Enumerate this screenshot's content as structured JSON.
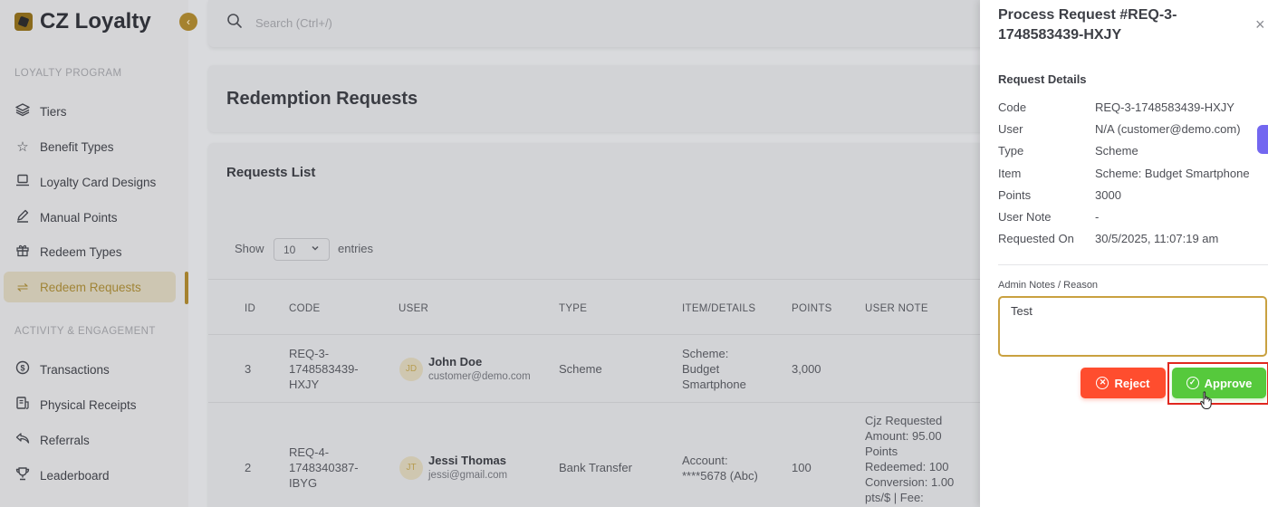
{
  "brand": {
    "name": "CZ Loyalty"
  },
  "sidebar": {
    "sections": [
      {
        "label": "LOYALTY PROGRAM"
      },
      {
        "label": "ACTIVITY & ENGAGEMENT"
      }
    ],
    "items": [
      {
        "label": "Tiers",
        "icon": "layers-icon"
      },
      {
        "label": "Benefit Types",
        "icon": "star-icon"
      },
      {
        "label": "Loyalty Card Designs",
        "icon": "laptop-icon"
      },
      {
        "label": "Manual Points",
        "icon": "pencil-icon"
      },
      {
        "label": "Redeem Types",
        "icon": "gift-icon"
      },
      {
        "label": "Redeem Requests",
        "icon": "swap-icon",
        "active": true
      },
      {
        "label": "Transactions",
        "icon": "dollar-icon"
      },
      {
        "label": "Physical Receipts",
        "icon": "receipt-icon"
      },
      {
        "label": "Referrals",
        "icon": "share-icon"
      },
      {
        "label": "Leaderboard",
        "icon": "trophy-icon"
      }
    ]
  },
  "search": {
    "placeholder": "Search (Ctrl+/)"
  },
  "page": {
    "title": "Redemption Requests"
  },
  "list": {
    "title": "Requests List",
    "show_label": "Show",
    "entries_value": "10",
    "entries_label": "entries",
    "columns": [
      "ID",
      "CODE",
      "USER",
      "TYPE",
      "ITEM/DETAILS",
      "POINTS",
      "USER NOTE"
    ],
    "rows": [
      {
        "id": "3",
        "code": "REQ-3-\n1748583439-\nHXJY",
        "initials": "JD",
        "user_name": "John Doe",
        "user_email": "customer@demo.com",
        "type": "Scheme",
        "item": "Scheme:\nBudget\nSmartphone",
        "points": "3,000",
        "note": ""
      },
      {
        "id": "2",
        "code": "REQ-4-\n1748340387-\nIBYG",
        "initials": "JT",
        "user_name": "Jessi Thomas",
        "user_email": "jessi@gmail.com",
        "type": "Bank Transfer",
        "item": "Account:\n****5678 (Abc)",
        "points": "100",
        "note": "Cjz Requested\nAmount: 95.00\nPoints\nRedeemed: 100\nConversion: 1.00\npts/$ | Fee:"
      }
    ]
  },
  "drawer": {
    "title": "Process Request #REQ-3-1748583439-HXJY",
    "close_icon": "×",
    "details_title": "Request Details",
    "details": [
      {
        "key": "Code",
        "value": "REQ-3-1748583439-HXJY"
      },
      {
        "key": "User",
        "value": "N/A (customer@demo.com)"
      },
      {
        "key": "Type",
        "value": "Scheme"
      },
      {
        "key": "Item",
        "value": "Scheme: Budget Smartphone"
      },
      {
        "key": "Points",
        "value": "3000"
      },
      {
        "key": "User Note",
        "value": "-"
      },
      {
        "key": "Requested On",
        "value": "30/5/2025, 11:07:19 am"
      }
    ],
    "notes_label": "Admin Notes / Reason",
    "notes_value": "Test",
    "reject_label": "Reject",
    "approve_label": "Approve"
  },
  "colors": {
    "accent": "#a5822f",
    "reject": "#ff4d2e",
    "approve": "#56c93c",
    "highlight": "#e0281f",
    "side_tab": "#7367f0"
  }
}
